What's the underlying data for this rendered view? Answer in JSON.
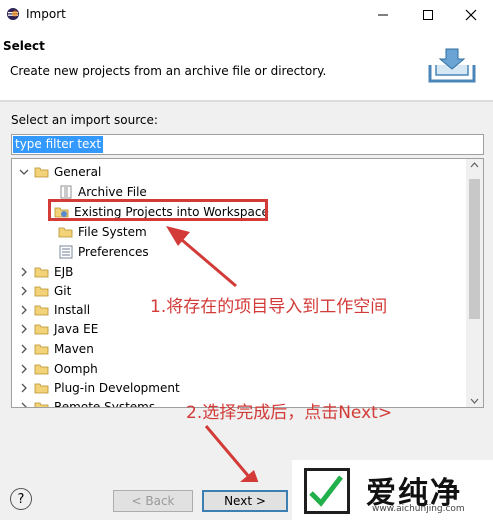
{
  "window": {
    "title": "Import"
  },
  "header": {
    "title": "Select",
    "description": "Create new projects from an archive file or directory."
  },
  "source": {
    "label": "Select an import source:",
    "filter_value": "type filter text"
  },
  "tree": {
    "items": [
      {
        "label": "General"
      },
      {
        "label": "Archive File"
      },
      {
        "label": "Existing Projects into Workspace"
      },
      {
        "label": "File System"
      },
      {
        "label": "Preferences"
      },
      {
        "label": "EJB"
      },
      {
        "label": "Git"
      },
      {
        "label": "Install"
      },
      {
        "label": "Java EE"
      },
      {
        "label": "Maven"
      },
      {
        "label": "Oomph"
      },
      {
        "label": "Plug-in Development"
      },
      {
        "label": "Remote Systems"
      }
    ]
  },
  "annotations": {
    "step1": "1.将存在的项目导入到工作空间",
    "step2": "2.选择完成后，点击Next>"
  },
  "buttons": {
    "back": "< Back",
    "next": "Next >"
  },
  "watermark": {
    "text": "爱纯净",
    "url": "www.aichunjing.com"
  },
  "colors": {
    "annotation": "#d23b38",
    "selection": "#3399ff",
    "folder": "#e8c15c"
  }
}
